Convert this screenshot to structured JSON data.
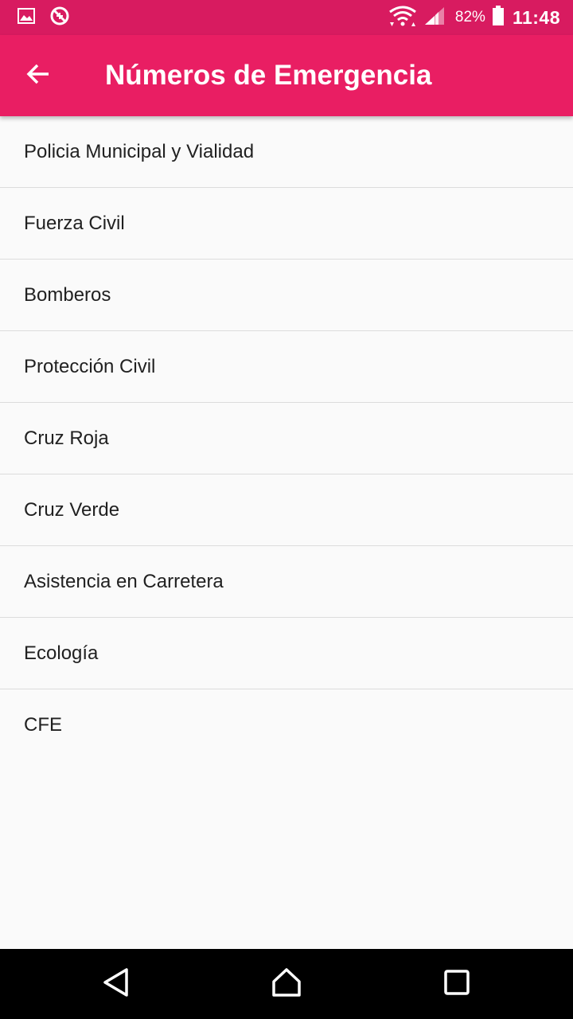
{
  "status_bar": {
    "battery_percent": "82%",
    "time": "11:48",
    "icons": [
      "image-icon",
      "sync-disabled-icon",
      "wifi-icon",
      "cell-signal-icon",
      "battery-icon"
    ]
  },
  "app_bar": {
    "title": "Números de Emergencia",
    "back_icon": "arrow-back-icon"
  },
  "list": {
    "items": [
      {
        "label": "Policia Municipal y Vialidad"
      },
      {
        "label": "Fuerza Civil"
      },
      {
        "label": "Bomberos"
      },
      {
        "label": "Protección Civil"
      },
      {
        "label": "Cruz Roja"
      },
      {
        "label": "Cruz Verde"
      },
      {
        "label": "Asistencia en Carretera"
      },
      {
        "label": "Ecología"
      },
      {
        "label": "CFE"
      }
    ]
  },
  "nav_bar": {
    "icons": [
      "back-triangle-icon",
      "home-icon",
      "recents-square-icon"
    ]
  },
  "colors": {
    "status_bar": "#d81b60",
    "app_bar": "#e91e63",
    "background": "#fafafa",
    "divider": "#dcdcdc",
    "text": "#212121"
  }
}
